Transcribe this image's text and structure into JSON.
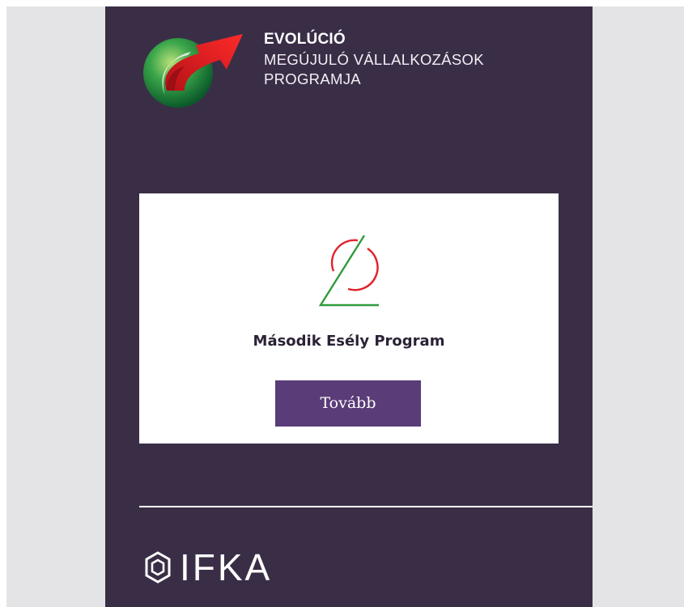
{
  "header": {
    "brand_title": "EVOLÚCIÓ",
    "brand_sub_line1": "MEGÚJULÓ VÁLLALKOZÁSOK",
    "brand_sub_line2": "PROGRAMJA",
    "logo_icon": "evolucio-logo-icon"
  },
  "card": {
    "logo_icon": "masodik-esely-logo-icon",
    "title": "Második Esély Program",
    "button_label": "Tovább"
  },
  "footer": {
    "logo_icon": "ifka-hexagon-icon",
    "logo_text": "IFKA"
  },
  "colors": {
    "panel": "#3a2e47",
    "button": "#5a3c78",
    "side_bg": "#e4e4e6",
    "accent_red": "#e2222a",
    "accent_green": "#2f9a3c"
  }
}
